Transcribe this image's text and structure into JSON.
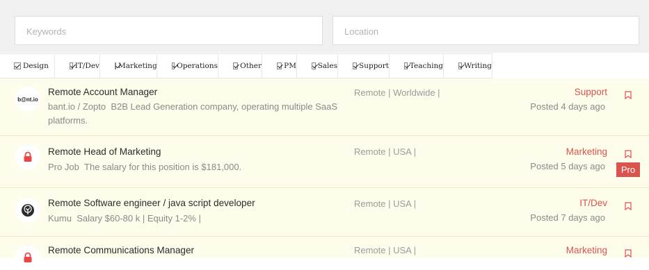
{
  "search": {
    "keywords_placeholder": "Keywords",
    "location_placeholder": "Location"
  },
  "filters": [
    "Design",
    "IT/Dev",
    "Marketing",
    "Operations",
    "Other",
    "PM",
    "Sales",
    "Support",
    "Teaching",
    "Writing"
  ],
  "jobs": [
    {
      "logo_text": "b@nt.io",
      "title": "Remote Account Manager",
      "company": "bant.io / Zopto",
      "description": "B2B Lead Generation company, operating multiple SaaS platforms.",
      "location": "Remote | Worldwide |",
      "category": "Support",
      "posted": "Posted 4 days ago",
      "pro": false
    },
    {
      "logo_text": "",
      "title": "Remote Head of Marketing",
      "company": "Pro Job",
      "description": "The salary for this position is $181,000.",
      "location": "Remote | USA |",
      "category": "Marketing",
      "posted": "Posted 5 days ago",
      "pro": true,
      "pro_label": "Pro"
    },
    {
      "logo_text": "",
      "title": "Remote Software engineer / java script developer",
      "company": "Kumu",
      "description": "Salary $60-80 k | Equity 1-2% |",
      "location": "Remote | USA |",
      "category": "IT/Dev",
      "posted": "Posted 7 days ago",
      "pro": false
    },
    {
      "logo_text": "",
      "title": "Remote Communications Manager",
      "company": "",
      "description": "",
      "location": "Remote | USA |",
      "category": "Marketing",
      "posted": "",
      "pro": false
    }
  ],
  "colors": {
    "accent": "#d9534f",
    "row_background": "#fefcea",
    "search_background": "#f0f0f0"
  }
}
